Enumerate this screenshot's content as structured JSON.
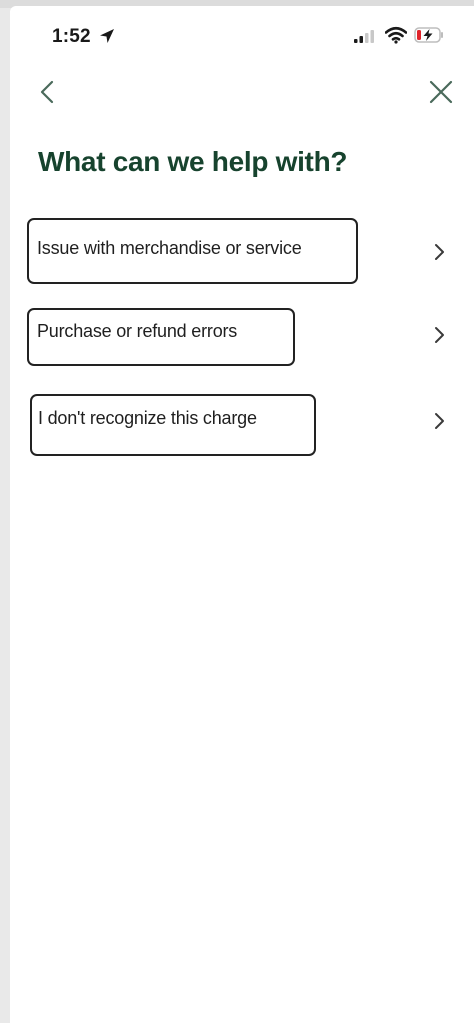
{
  "status_bar": {
    "time": "1:52"
  },
  "nav": {
    "back_icon": "chevron-left-icon",
    "close_icon": "close-icon"
  },
  "page": {
    "title": "What can we help with?"
  },
  "options": [
    {
      "label": "Issue with merchandise or service",
      "icon": "chevron-right-icon"
    },
    {
      "label": "Purchase or refund errors",
      "icon": "chevron-right-icon"
    },
    {
      "label": "I don't recognize this charge",
      "icon": "chevron-right-icon"
    }
  ],
  "colors": {
    "title": "#17432e",
    "border": "#222222",
    "text": "#1f1f1f",
    "background": "#ffffff"
  }
}
